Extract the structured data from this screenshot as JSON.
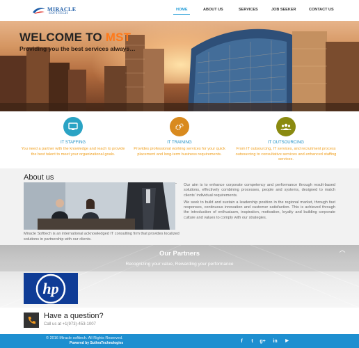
{
  "brand": {
    "name_line1": "MIRACLE",
    "name_line2": "SOFTTECH",
    "color": "#1a5aa6"
  },
  "nav": {
    "items": [
      {
        "label": "HOME",
        "active": true
      },
      {
        "label": "ABOUT US",
        "active": false
      },
      {
        "label": "SERVICES",
        "active": false
      },
      {
        "label": "JOB SEEKER",
        "active": false
      },
      {
        "label": "CONTACT US",
        "active": false
      }
    ],
    "active_color": "#1e9ad6"
  },
  "hero": {
    "title_prefix": "WELCOME TO ",
    "title_accent": "MST",
    "subtitle": "Providing you the best services always…",
    "accent_color": "#ff7a1a"
  },
  "services": [
    {
      "icon": "monitor-icon",
      "color": "#2aa3c4",
      "title": "IT STAFFING",
      "description": "You need a partner with the knowledge and reach to provide the best talent to meet your organizational goals."
    },
    {
      "icon": "gears-icon",
      "color": "#d98a1e",
      "title": "IT TRAINING",
      "description": "Provides professional working services for your quick placement and long-term business requirements."
    },
    {
      "icon": "people-icon",
      "color": "#8a8a10",
      "title": "IT OUTSOURCING",
      "description": "From IT outsourcing, IT services, and recruitment process outsourcing to consultative services and enhanced staffing services."
    }
  ],
  "about": {
    "title": "About us",
    "caption": "Miracle Softtech is an international acknowledged IT consulting firm that provides localized solutions in partnership with our clients.",
    "paragraph1": "Our aim is to enhance corporate competency and performance through result-based solutions, effectively combining processes, people and systems, designed to match clients' individual requirements.",
    "paragraph2": "We seek to build and sustain a leadership position in the regional market, through fast responses, continuous innovation and customer satisfaction. This is achieved through the introduction of enthusiasm, inspiration, motivation, loyalty and building corporate culture and values to comply with our strategies."
  },
  "partners": {
    "title": "Our Partners",
    "subtitle": "Recognizing your value, Rewarding your performance",
    "logo_text": "hp",
    "logo_color": "#0f3c96"
  },
  "question": {
    "title": "Have a question?",
    "call_text": "Call us at +1(973)-453-1007"
  },
  "footer": {
    "copyright": "© 2016 Miracle softtech. All Rights Reserved.",
    "powered_by": "Powered by SuthraTechnologies",
    "social": [
      {
        "icon": "facebook-icon",
        "glyph": "f"
      },
      {
        "icon": "twitter-icon",
        "glyph": "t"
      },
      {
        "icon": "googleplus-icon",
        "glyph": "g+"
      },
      {
        "icon": "linkedin-icon",
        "glyph": "in"
      },
      {
        "icon": "youtube-icon",
        "glyph": "▶"
      }
    ],
    "bg_color": "#1e8fd0"
  }
}
